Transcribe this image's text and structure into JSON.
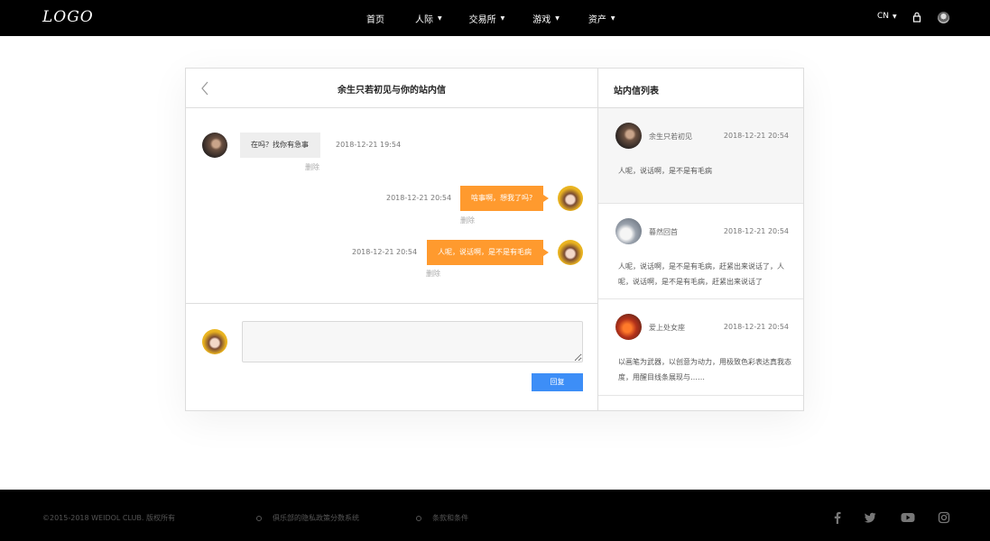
{
  "header": {
    "logo_text": "LOGO",
    "nav": [
      {
        "label": "首页",
        "has_dropdown": false
      },
      {
        "label": "人际",
        "has_dropdown": true
      },
      {
        "label": "交易所",
        "has_dropdown": true
      },
      {
        "label": "游戏",
        "has_dropdown": true
      },
      {
        "label": "资产",
        "has_dropdown": true
      }
    ],
    "language": "CN",
    "icons": [
      "lock-icon",
      "user-avatar"
    ]
  },
  "chat": {
    "title": "余生只若初见与你的站内信",
    "messages": [
      {
        "direction": "incoming",
        "text": "在吗？找你有急事",
        "time": "2018-12-21  19:54",
        "delete_label": "删除"
      },
      {
        "direction": "outgoing",
        "text": "啥事啊，想我了吗?",
        "time": "2018-12-21  20:54",
        "delete_label": "删除"
      },
      {
        "direction": "outgoing",
        "text": "人呢，说话啊，是不是有毛病",
        "time": "2018-12-21  20:54",
        "delete_label": "删除"
      }
    ],
    "reply_placeholder": "",
    "reply_button": "回复"
  },
  "list": {
    "title": "站内信列表",
    "items": [
      {
        "name": "余生只若初见",
        "time": "2018-12-21  20:54",
        "preview": "人呢，说话啊，是不是有毛病",
        "active": true
      },
      {
        "name": "暮然回首",
        "time": "2018-12-21  20:54",
        "preview": "人呢，说话啊，是不是有毛病，赶紧出来说话了，人呢，说话啊，是不是有毛病，赶紧出来说话了",
        "active": false
      },
      {
        "name": "爱上处女座",
        "time": "2018-12-21  20:54",
        "preview": "以画笔为武器，以创意为动力，用极致色彩表达真我态度，用醒目线条展现与……",
        "active": false
      }
    ]
  },
  "footer": {
    "copyright": "©2015-2018 WEIDOL CLUB. 版权所有",
    "links": [
      "俱乐部的隐私政策分数系统",
      "条款和条件"
    ],
    "social": [
      "facebook-icon",
      "twitter-icon",
      "youtube-icon",
      "instagram-icon"
    ]
  },
  "colors": {
    "accent_orange": "#ff9a2e",
    "button_blue": "#3d8ef7",
    "bar_black": "#000000"
  }
}
